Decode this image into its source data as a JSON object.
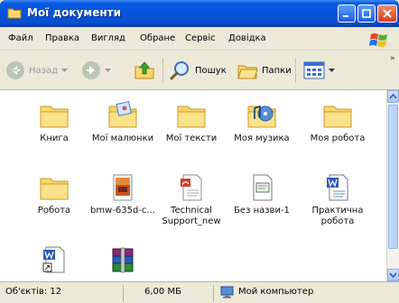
{
  "window": {
    "title": "Мої документи"
  },
  "menu": {
    "items": [
      "Файл",
      "Правка",
      "Вигляд",
      "Обране",
      "Сервіс",
      "Довідка"
    ]
  },
  "toolbar": {
    "back_label": "Назад",
    "search_label": "Пошук",
    "folders_label": "Папки",
    "overflow": "»"
  },
  "files": [
    {
      "name": "Книга",
      "icon": "folder-icon"
    },
    {
      "name": "Мої малюнки",
      "icon": "pictures-folder-icon"
    },
    {
      "name": "Мої тексти",
      "icon": "folder-icon"
    },
    {
      "name": "Моя музика",
      "icon": "music-folder-icon"
    },
    {
      "name": "Моя робота",
      "icon": "folder-icon"
    },
    {
      "name": "Робота",
      "icon": "folder-icon"
    },
    {
      "name": "bmw-635d-c...",
      "icon": "image-file-icon"
    },
    {
      "name": "Technical Support_new",
      "icon": "pdf-document-icon"
    },
    {
      "name": "Без назви-1",
      "icon": "text-document-icon"
    },
    {
      "name": "Практична робота",
      "icon": "word-document-icon"
    },
    {
      "name": "",
      "icon": "word-shortcut-icon"
    },
    {
      "name": "",
      "icon": "winrar-archive-icon"
    }
  ],
  "status": {
    "objects": "Об'єктів: 12",
    "size": "6,00 МБ",
    "location": "Мой компьютер"
  },
  "colors": {
    "titlebar": "#0554dd",
    "folder": "#f8d66b",
    "chrome": "#ece9d8"
  }
}
